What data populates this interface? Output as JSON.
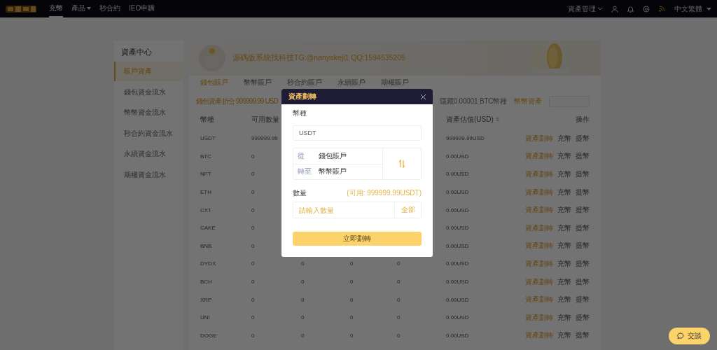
{
  "topbar": {
    "nav": [
      {
        "label": "充幣",
        "selected": true,
        "dropdown": false
      },
      {
        "label": "產品",
        "selected": false,
        "dropdown": true
      },
      {
        "label": "秒合約",
        "selected": false,
        "dropdown": false
      },
      {
        "label": "IEO申購",
        "selected": false,
        "dropdown": false
      }
    ],
    "asset_menu": "資產管理",
    "language": "中文繁體"
  },
  "sidebar": {
    "title": "資產中心",
    "items": [
      {
        "label": "賬戶資產",
        "selected": true
      },
      {
        "label": "錢包資金流水",
        "selected": false
      },
      {
        "label": "幣幣資金流水",
        "selected": false
      },
      {
        "label": "秒合約資金流水",
        "selected": false
      },
      {
        "label": "永續資金流水",
        "selected": false
      },
      {
        "label": "期權資金流水",
        "selected": false
      }
    ]
  },
  "banner": {
    "text": "源碼版系統找科技TG:@nanyakeji1 QQ:1594535205"
  },
  "account_tabs": [
    {
      "label": "錢包賬戶",
      "selected": true
    },
    {
      "label": "幣幣賬戶",
      "selected": false
    },
    {
      "label": "秒合約賬戶",
      "selected": false
    },
    {
      "label": "永續賬戶",
      "selected": false
    },
    {
      "label": "期權賬戶",
      "selected": false
    }
  ],
  "summary": {
    "total": "錢包資產折合 999999.99 USD",
    "hide_small": "隱藏0.00001 BTC幣種",
    "link": "幣幣資產"
  },
  "table": {
    "columns": [
      {
        "label": "幣種",
        "sortable": false
      },
      {
        "label": "可用數量",
        "sortable": true
      },
      {
        "label": "資產估值(USD)",
        "sortable": true
      },
      {
        "label": "操作",
        "sortable": false
      }
    ],
    "rows": [
      {
        "coin": "USDT",
        "available": "999999.99",
        "value": "999999.99USD",
        "actions": [
          "資產劃轉",
          "充幣",
          "提幣"
        ]
      },
      {
        "coin": "BTC",
        "available": "0",
        "value": "0.00USD",
        "actions": [
          "資產劃轉",
          "充幣",
          "提幣"
        ]
      },
      {
        "coin": "NFT",
        "available": "0",
        "value": "0.00USD",
        "actions": [
          "資產劃轉",
          "充幣",
          "提幣"
        ]
      },
      {
        "coin": "ETH",
        "available": "0",
        "value": "0.00USD",
        "actions": [
          "資產劃轉",
          "充幣",
          "提幣"
        ]
      },
      {
        "coin": "CXT",
        "available": "0",
        "value": "0.00USD",
        "actions": [
          "資產劃轉",
          "充幣",
          "提幣"
        ]
      },
      {
        "coin": "CAKE",
        "available": "0",
        "value": "0.00USD",
        "actions": [
          "資產劃轉",
          "充幣",
          "提幣"
        ]
      },
      {
        "coin": "BNB",
        "available": "0",
        "value": "0.00USD",
        "actions": [
          "資產劃轉",
          "充幣",
          "提幣"
        ]
      },
      {
        "coin": "DYDX",
        "available": "0",
        "column_3": "0",
        "column_4": "0",
        "column_5": "0",
        "value": "0.00USD",
        "actions": [
          "資產劃轉",
          "充幣",
          "提幣"
        ]
      },
      {
        "coin": "BCH",
        "available": "0",
        "column_3": "0",
        "column_4": "0",
        "column_5": "0",
        "value": "0.00USD",
        "actions": [
          "資產劃轉",
          "充幣",
          "提幣"
        ]
      },
      {
        "coin": "XRP",
        "available": "0",
        "column_3": "0",
        "column_4": "0",
        "column_5": "0",
        "value": "0.00USD",
        "actions": [
          "資產劃轉",
          "充幣",
          "提幣"
        ]
      },
      {
        "coin": "UNI",
        "available": "0",
        "column_3": "0",
        "column_4": "0",
        "column_5": "0",
        "value": "0.00USD",
        "actions": [
          "資產劃轉",
          "充幣",
          "提幣"
        ]
      },
      {
        "coin": "DOGE",
        "available": "0",
        "column_3": "0",
        "column_4": "0",
        "column_5": "0",
        "value": "0.00USD",
        "actions": [
          "資產劃轉",
          "充幣",
          "提幣"
        ]
      }
    ]
  },
  "modal": {
    "title": "資產劃轉",
    "coin_label": "幣種",
    "coin_value": "USDT",
    "from_label": "從",
    "from_account": "錢包賬戶",
    "to_label": "轉至",
    "to_account": "幣幣賬戶",
    "amount_label": "數量",
    "available": "(可用: 999999.99USDT)",
    "amount_placeholder": "請輸入數量",
    "all_button": "全部",
    "submit": "立即劃轉"
  },
  "chat_button": {
    "label": "交談"
  }
}
